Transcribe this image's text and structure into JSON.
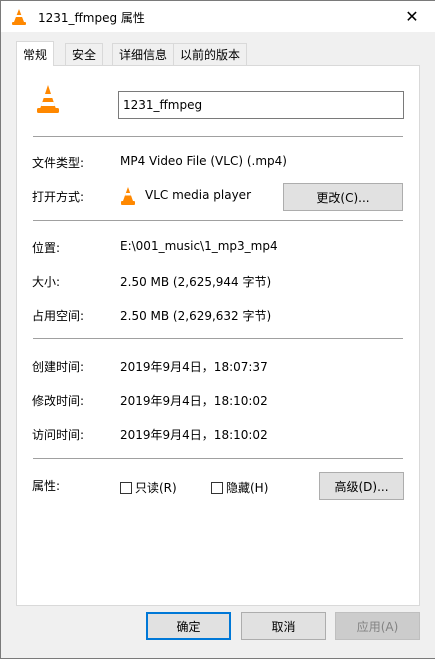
{
  "window": {
    "title": "1231_ffmpeg 属性",
    "close_glyph": "✕"
  },
  "tabs": [
    {
      "label": "常规",
      "active": true
    },
    {
      "label": "安全"
    },
    {
      "label": "详细信息"
    },
    {
      "label": "以前的版本"
    }
  ],
  "general": {
    "file_name": "1231_ffmpeg",
    "type_label": "文件类型:",
    "type_value": "MP4 Video File (VLC) (.mp4)",
    "opens_with_label": "打开方式:",
    "opens_with_value": "VLC media player",
    "change_button": "更改(C)...",
    "location_label": "位置:",
    "location_value": "E:\\001_music\\1_mp3_mp4",
    "size_label": "大小:",
    "size_value": "2.50 MB (2,625,944 字节)",
    "size_on_disk_label": "占用空间:",
    "size_on_disk_value": "2.50 MB (2,629,632 字节)",
    "created_label": "创建时间:",
    "created_value": "2019年9月4日，18:07:37",
    "modified_label": "修改时间:",
    "modified_value": "2019年9月4日，18:10:02",
    "accessed_label": "访问时间:",
    "accessed_value": "2019年9月4日，18:10:02",
    "attributes_label": "属性:",
    "readonly_label": "只读(R)",
    "hidden_label": "隐藏(H)",
    "advanced_button": "高级(D)..."
  },
  "footer": {
    "ok": "确定",
    "cancel": "取消",
    "apply": "应用(A)"
  },
  "icons": {
    "file_icon": "vlc-cone-icon"
  },
  "colors": {
    "accent": "#0078d7",
    "cone_orange": "#ff8800"
  }
}
